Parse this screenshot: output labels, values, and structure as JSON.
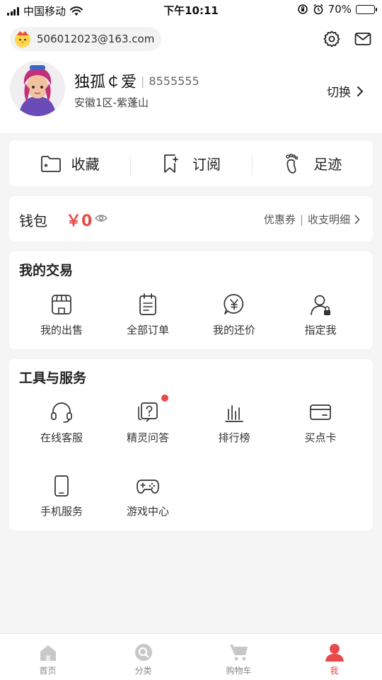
{
  "status_bar": {
    "carrier": "中国移动",
    "time": "下午10:11",
    "battery": "70%",
    "battery_level": 0.7
  },
  "header": {
    "email": "506012023@163.com",
    "user_name": "独孤￠爱",
    "user_id": "8555555",
    "server": "安徽1区-紫蓬山",
    "switch_label": "切换"
  },
  "quick_actions": [
    {
      "label": "收藏",
      "icon": "folder-icon"
    },
    {
      "label": "订阅",
      "icon": "bookmark-plus-icon"
    },
    {
      "label": "足迹",
      "icon": "footprint-icon"
    }
  ],
  "wallet": {
    "title": "钱包",
    "amount": "￥0",
    "coupon_label": "优惠券",
    "separator": "|",
    "detail_label": "收支明细"
  },
  "trade": {
    "title": "我的交易",
    "items": [
      {
        "label": "我的出售",
        "icon": "shop-icon"
      },
      {
        "label": "全部订单",
        "icon": "order-list-icon"
      },
      {
        "label": "我的还价",
        "icon": "yuan-bubble-icon"
      },
      {
        "label": "指定我",
        "icon": "user-lock-icon"
      }
    ]
  },
  "tools": {
    "title": "工具与服务",
    "items": [
      {
        "label": "在线客服",
        "icon": "headset-icon"
      },
      {
        "label": "精灵问答",
        "icon": "question-chat-icon"
      },
      {
        "label": "排行榜",
        "icon": "ranking-icon"
      },
      {
        "label": "买点卡",
        "icon": "card-icon"
      },
      {
        "label": "手机服务",
        "icon": "phone-icon"
      },
      {
        "label": "游戏中心",
        "icon": "gamepad-icon"
      }
    ]
  },
  "tabbar": [
    {
      "label": "首页",
      "icon": "home-icon"
    },
    {
      "label": "分类",
      "icon": "search-icon"
    },
    {
      "label": "购物车",
      "icon": "cart-icon"
    },
    {
      "label": "我",
      "icon": "profile-icon"
    }
  ],
  "colors": {
    "accent": "#e84a4a",
    "background": "#f5f5f5",
    "tab_inactive": "#888888"
  }
}
